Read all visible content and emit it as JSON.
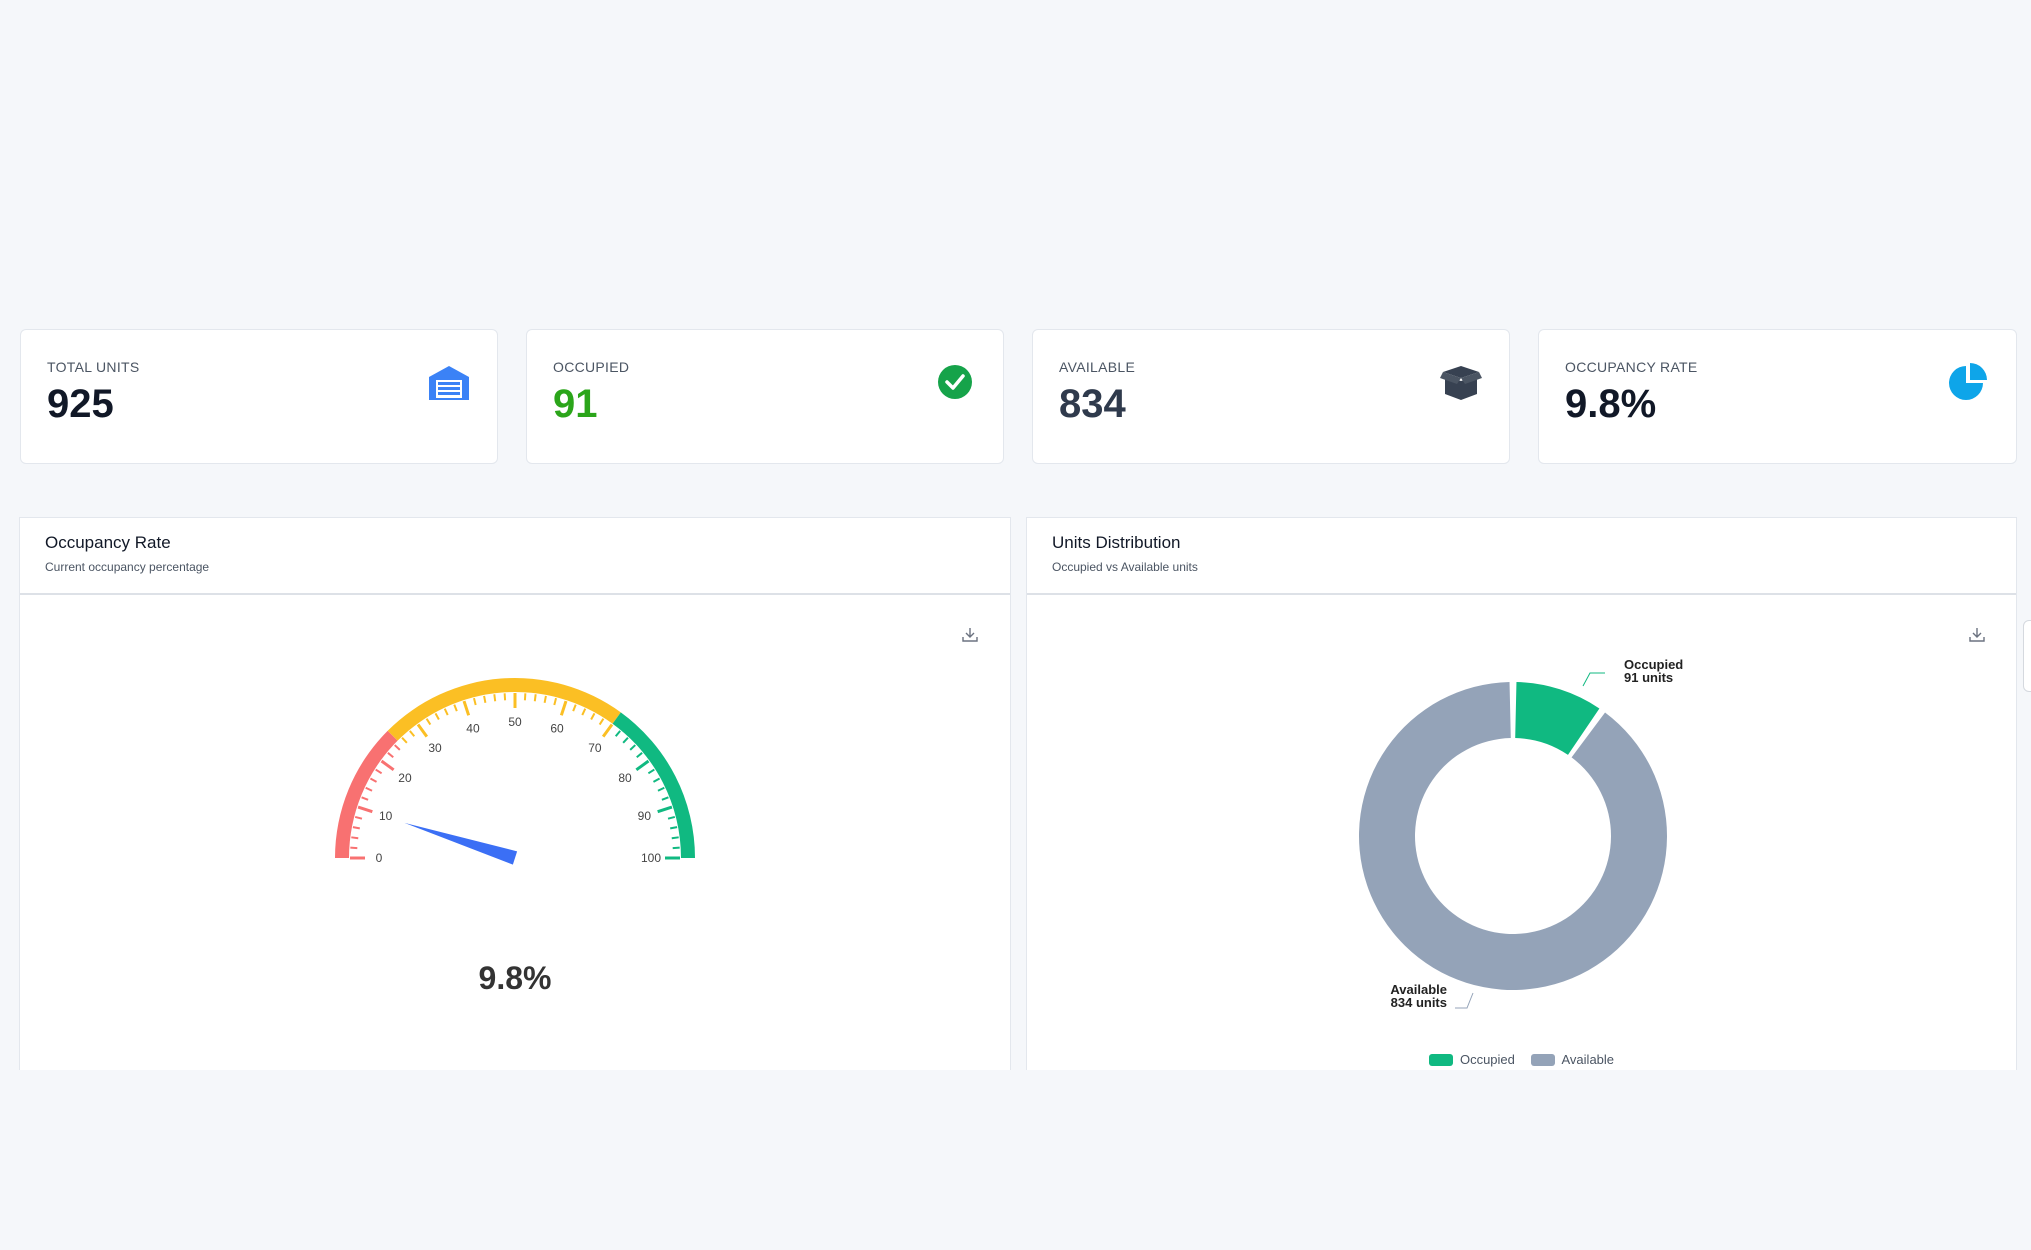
{
  "stats": {
    "total_units": {
      "label": "TOTAL UNITS",
      "value": "925",
      "icon": "warehouse-icon",
      "color": "#3b82f6"
    },
    "occupied": {
      "label": "OCCUPIED",
      "value": "91",
      "icon": "check-circle-icon",
      "color": "#16a34a"
    },
    "available": {
      "label": "AVAILABLE",
      "value": "834",
      "icon": "open-box-icon",
      "color": "#374151"
    },
    "occupancy_rate": {
      "label": "OCCUPANCY RATE",
      "value": "9.8%",
      "icon": "pie-chart-icon",
      "color": "#0ea5e9"
    }
  },
  "gauge_panel": {
    "title": "Occupancy Rate",
    "subtitle": "Current occupancy percentage",
    "download_icon": "download-icon"
  },
  "donut_panel": {
    "title": "Units Distribution",
    "subtitle": "Occupied vs Available units",
    "download_icon": "download-icon"
  },
  "chart_data": [
    {
      "type": "gauge",
      "value": 9.8,
      "value_label": "9.8%",
      "min": 0,
      "max": 100,
      "tick_labels": [
        "0",
        "10",
        "20",
        "30",
        "40",
        "50",
        "60",
        "70",
        "80",
        "90",
        "100"
      ],
      "bands": [
        {
          "from": 0,
          "to": 25,
          "color": "#f87171"
        },
        {
          "from": 25,
          "to": 70,
          "color": "#fbbf24"
        },
        {
          "from": 70,
          "to": 100,
          "color": "#10b981"
        }
      ],
      "needle_color": "#3b6ff5"
    },
    {
      "type": "pie",
      "donut": true,
      "categories": [
        "Occupied",
        "Available"
      ],
      "values": [
        91,
        834
      ],
      "colors": [
        "#10b981",
        "#94a3b8"
      ],
      "callouts": [
        {
          "name": "Occupied",
          "detail": "91 units"
        },
        {
          "name": "Available",
          "detail": "834 units"
        }
      ],
      "legend": [
        "Occupied",
        "Available"
      ],
      "legend_position": "bottom"
    }
  ]
}
